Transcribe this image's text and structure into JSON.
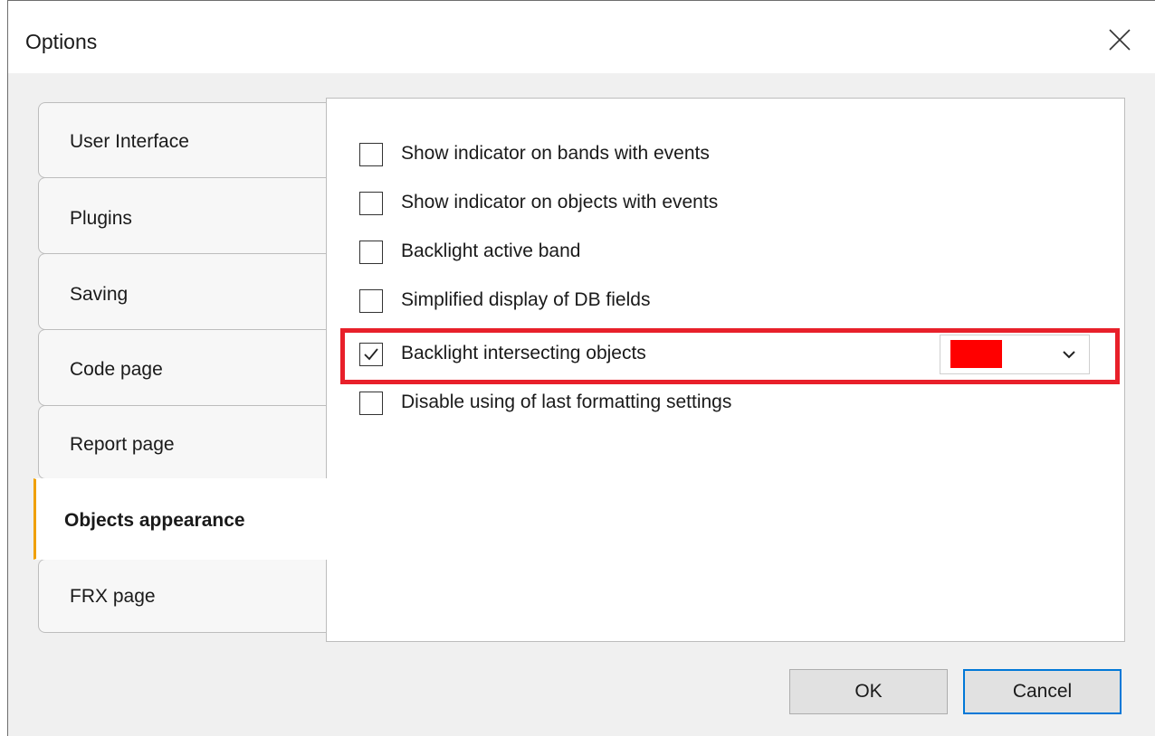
{
  "window": {
    "title": "Options"
  },
  "tabs": [
    {
      "label": "User Interface",
      "active": false
    },
    {
      "label": "Plugins",
      "active": false
    },
    {
      "label": "Saving",
      "active": false
    },
    {
      "label": "Code page",
      "active": false
    },
    {
      "label": "Report page",
      "active": false
    },
    {
      "label": "Objects appearance",
      "active": true
    },
    {
      "label": "FRX page",
      "active": false
    }
  ],
  "options": [
    {
      "label": "Show indicator on bands with events",
      "checked": false
    },
    {
      "label": "Show indicator on objects with events",
      "checked": false
    },
    {
      "label": "Backlight active band",
      "checked": false
    },
    {
      "label": "Simplified display of DB fields",
      "checked": false
    },
    {
      "label": "Backlight intersecting objects",
      "checked": true
    },
    {
      "label": "Disable using of last formatting settings",
      "checked": false
    }
  ],
  "backlight_color": {
    "value": "#ff0000",
    "highlight_color": "#e8202a"
  },
  "buttons": {
    "ok": "OK",
    "cancel": "Cancel"
  },
  "colors": {
    "active_tab_accent": "#f0a000",
    "focus_border": "#0078d7"
  },
  "icons": {
    "close": "close-icon",
    "check": "checkmark-icon",
    "dropdown": "chevron-down-icon"
  }
}
